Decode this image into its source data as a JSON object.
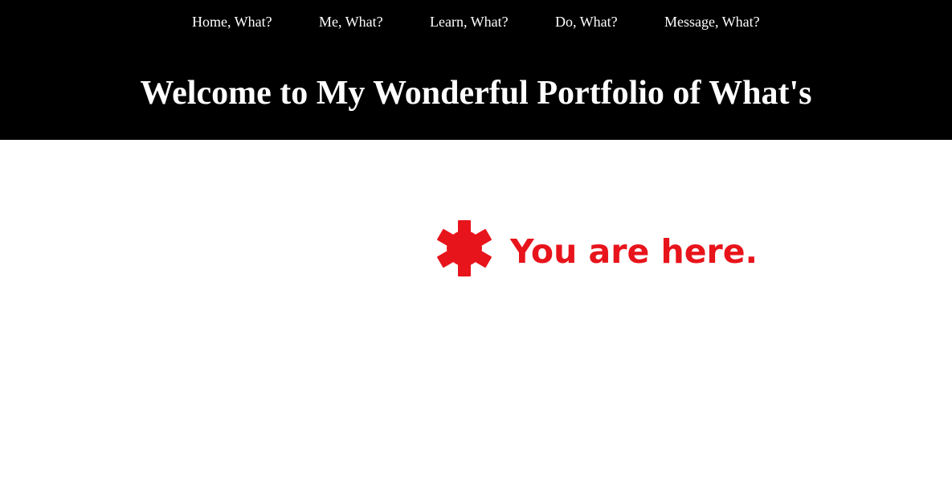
{
  "nav": {
    "items": [
      {
        "label": "Home, What?"
      },
      {
        "label": "Me, What?"
      },
      {
        "label": "Learn, What?"
      },
      {
        "label": "Do, What?"
      },
      {
        "label": "Message, What?"
      }
    ]
  },
  "header": {
    "title": "Welcome to My Wonderful Portfolio of What's"
  },
  "main": {
    "marker_icon": "asterisk-marker-icon",
    "location_text": "You are here."
  },
  "colors": {
    "header_background": "#000000",
    "header_text": "#ffffff",
    "page_background": "#ffffff",
    "accent_red": "#e8141b"
  }
}
